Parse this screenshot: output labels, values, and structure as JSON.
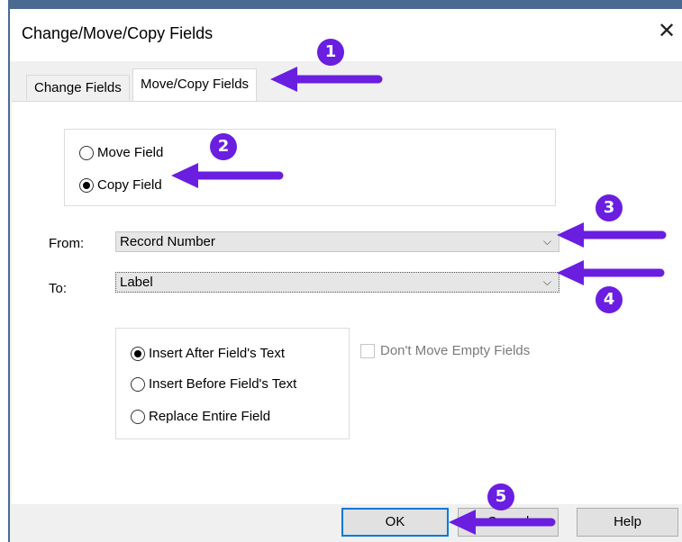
{
  "window": {
    "title": "Change/Move/Copy Fields",
    "close_glyph": "✕"
  },
  "tabs": [
    {
      "label": "Change Fields",
      "active": false
    },
    {
      "label": "Move/Copy Fields",
      "active": true
    }
  ],
  "mode_group": {
    "options": [
      {
        "label": "Move Field",
        "selected": false
      },
      {
        "label": "Copy Field",
        "selected": true
      }
    ]
  },
  "from": {
    "label": "From:",
    "value": "Record Number"
  },
  "to": {
    "label": "To:",
    "value": "Label"
  },
  "placement_group": {
    "options": [
      {
        "label": "Insert After Field's Text",
        "selected": true
      },
      {
        "label": "Insert Before Field's Text",
        "selected": false
      },
      {
        "label": "Replace Entire Field",
        "selected": false
      }
    ]
  },
  "dont_move_empty": {
    "label": "Don't Move Empty Fields",
    "checked": false,
    "enabled": false
  },
  "buttons": {
    "ok": "OK",
    "cancel": "Cancel",
    "help": "Help"
  },
  "annotations": {
    "color": "#6a1ee0",
    "badges": [
      "1",
      "2",
      "3",
      "4",
      "5"
    ]
  },
  "icons": {
    "close": "close-icon",
    "chevron": "chevron-down-icon",
    "chevron_glyph": "⌵"
  }
}
